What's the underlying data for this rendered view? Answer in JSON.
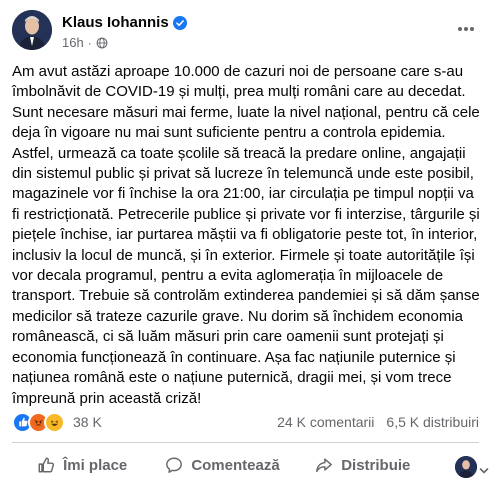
{
  "post": {
    "author": "Klaus Iohannis",
    "time": "16h",
    "body": "Am avut astăzi aproape 10.000 de cazuri noi de persoane care s-au îmbolnăvit de COVID-19 și mulți, prea mulți români care au decedat. Sunt necesare măsuri mai ferme, luate la nivel național, pentru că cele deja în vigoare nu mai sunt suficiente pentru a controla epidemia. Astfel, urmează ca toate școlile să treacă la predare online, angajații din sistemul public și privat să lucreze în telemuncă unde este posibil, magazinele vor fi închise la ora 21:00, iar circulația pe timpul nopții va fi restricționată. Petrecerile publice și private vor fi interzise, târgurile și piețele închise, iar purtarea măștii va fi obligatorie peste tot, în interior, inclusiv la locul de muncă, și în exterior. Firmele și toate autoritățile își vor decala programul, pentru a evita aglomerația în mijloacele de transport. Trebuie să controlăm extinderea pandemiei și să dăm șanse medicilor să trateze cazurile grave. Nu dorim să închidem economia românească, ci să luăm măsuri prin care oamenii sunt protejați și economia funcționează în continuare. Așa fac națiunile puternice și națiunea română este o națiune puternică, dragii mei, și vom trece împreună prin această criză!"
  },
  "stats": {
    "reactions_count": "38 K",
    "comments": "24 K comentarii",
    "shares": "6,5 K distribuiri"
  },
  "actions": {
    "like": "Îmi place",
    "comment": "Comentează",
    "share": "Distribuie"
  },
  "icons": {
    "verified": "verified-badge-icon",
    "audience": "globe-icon",
    "more": "more-options-icon",
    "reactions": [
      "like-reaction-icon",
      "angry-reaction-icon",
      "haha-reaction-icon"
    ],
    "like": "thumbs-up-icon",
    "comment": "comment-bubble-icon",
    "share": "share-arrow-icon",
    "page_selector": "chevron-down-icon"
  },
  "colors": {
    "accent": "#1877f2",
    "text": "#050505",
    "secondary": "#65676b",
    "divider": "#ced0d4"
  }
}
